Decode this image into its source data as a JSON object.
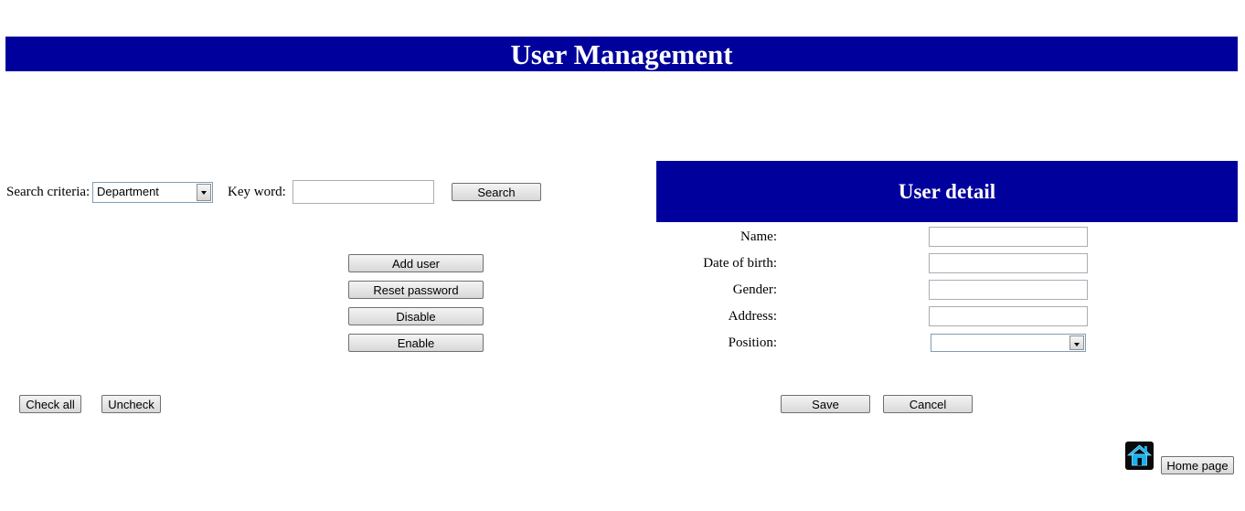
{
  "header": {
    "title": "User Management"
  },
  "search": {
    "criteria_label": "Search criteria:",
    "criteria_selected": "Department",
    "keyword_label": "Key word:",
    "keyword_value": "",
    "search_button": "Search"
  },
  "actions": {
    "add_user": "Add user",
    "reset_password": "Reset password",
    "disable": "Disable",
    "enable": "Enable"
  },
  "selection": {
    "check_all": "Check all",
    "uncheck": "Uncheck"
  },
  "user_detail": {
    "title": "User detail",
    "name_label": "Name:",
    "dob_label": "Date of birth:",
    "gender_label": "Gender:",
    "address_label": "Address:",
    "position_label": "Position:",
    "name_value": "",
    "dob_value": "",
    "gender_value": "",
    "address_value": "",
    "position_selected": "",
    "save": "Save",
    "cancel": "Cancel"
  },
  "footer": {
    "home_page": "Home page",
    "home_icon": "home-icon"
  },
  "colors": {
    "header_bg": "#00009c",
    "icon_blue": "#19b0f0"
  }
}
